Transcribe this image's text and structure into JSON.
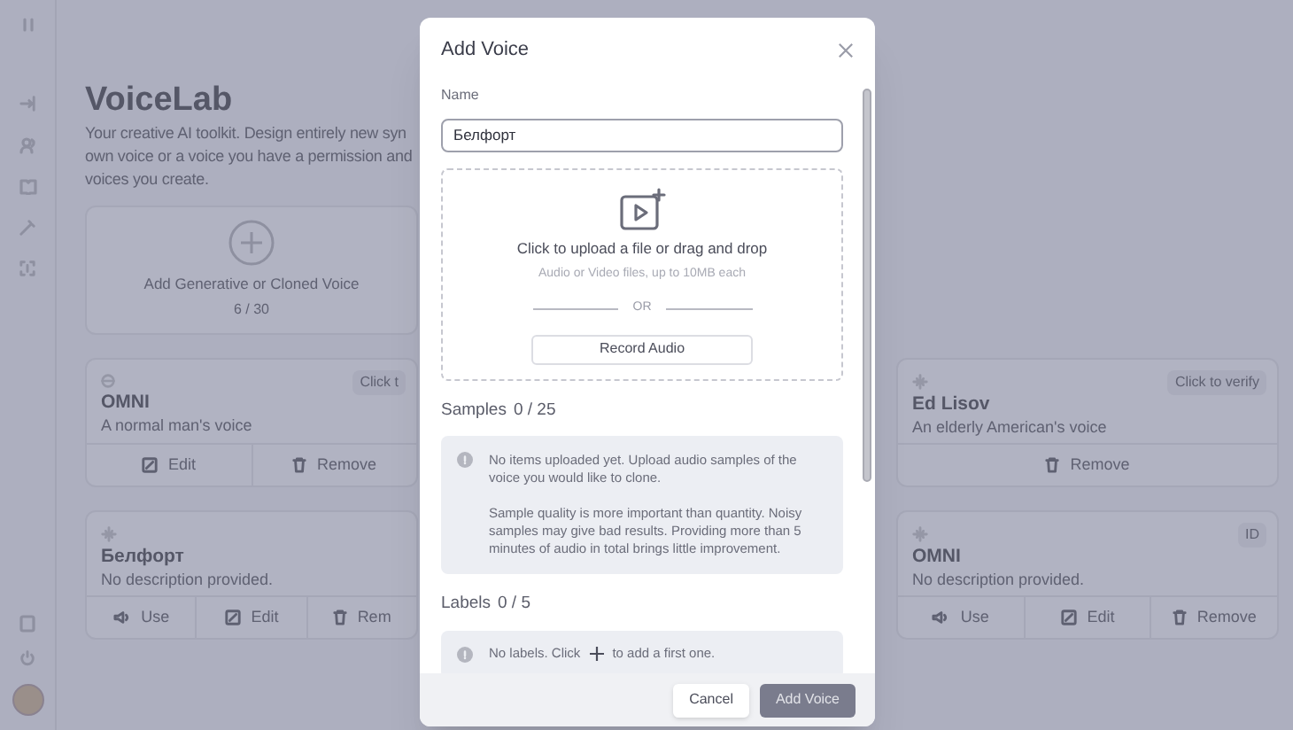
{
  "page": {
    "title": "VoiceLab",
    "description_lines": [
      "Your creative AI toolkit. Design entirely new syn",
      "own voice or a voice you have a permission and",
      "voices you create."
    ]
  },
  "add_card": {
    "label": "Add Generative or Cloned Voice",
    "count": "6 / 30"
  },
  "left_cards": [
    {
      "kind": "designed",
      "name": "OMNI",
      "description": "A normal man's voice",
      "badge": "Click t",
      "actions": [
        {
          "kind": "edit",
          "label": "Edit"
        },
        {
          "kind": "remove",
          "label": "Remove"
        }
      ]
    },
    {
      "kind": "cloned",
      "name": "Белфорт",
      "description": "No description provided.",
      "actions": [
        {
          "kind": "use",
          "label": "Use"
        },
        {
          "kind": "edit",
          "label": "Edit"
        },
        {
          "kind": "remove",
          "label": "Rem"
        }
      ]
    }
  ],
  "right_cards": [
    {
      "kind": "cloned",
      "name": "Ed Lisov",
      "description": "An elderly American's voice",
      "badge": "Click to verify",
      "actions": [
        {
          "kind": "remove",
          "label": "Remove"
        }
      ]
    },
    {
      "kind": "cloned",
      "name": "OMNI",
      "description": "No description provided.",
      "badge": "ID",
      "actions": [
        {
          "kind": "use",
          "label": "Use"
        },
        {
          "kind": "edit",
          "label": "Edit"
        },
        {
          "kind": "remove",
          "label": "Remove"
        }
      ]
    }
  ],
  "modal": {
    "title": "Add Voice",
    "name_field": {
      "label": "Name",
      "value": "Белфорт"
    },
    "upload": {
      "title": "Click to upload a file or drag and drop",
      "hint": "Audio or Video files, up to 10MB each",
      "divider": "OR",
      "button": "Record Audio"
    },
    "samples": {
      "label": "Samples",
      "count": "0 / 25",
      "messages": [
        "No items uploaded yet. Upload audio samples of the voice you would like to clone.",
        "Sample quality is more important than quantity. Noisy samples may give bad results. Providing more than 5 minutes of audio in total brings little improvement."
      ]
    },
    "labels": {
      "label": "Labels",
      "count": "0 / 5",
      "message_before": "No labels. Click",
      "message_after": "to add a first one."
    },
    "buttons": [
      {
        "kind": "secondary",
        "label": "Cancel",
        "disabled": false
      },
      {
        "kind": "primary",
        "label": "Add Voice",
        "disabled": true
      }
    ]
  }
}
